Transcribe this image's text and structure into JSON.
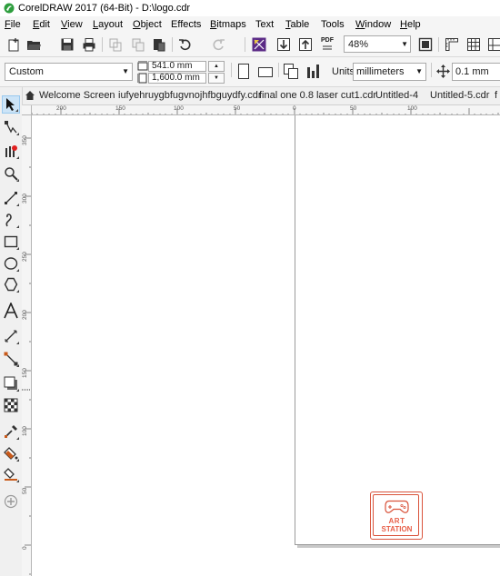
{
  "app": {
    "title": "CorelDRAW 2017 (64-Bit) - D:\\logo.cdr"
  },
  "menu": [
    {
      "label": "File",
      "mnemonic": "F",
      "rest": "ile"
    },
    {
      "label": "Edit",
      "mnemonic": "E",
      "rest": "dit"
    },
    {
      "label": "View",
      "mnemonic": "V",
      "rest": "iew"
    },
    {
      "label": "Layout",
      "mnemonic": "L",
      "rest": "ayout"
    },
    {
      "label": "Object",
      "mnemonic": "O",
      "rest": "bject"
    },
    {
      "label": "Effects",
      "mnemonic": "",
      "rest": "Effects"
    },
    {
      "label": "Bitmaps",
      "mnemonic": "B",
      "rest": "itmaps"
    },
    {
      "label": "Text",
      "mnemonic": "",
      "rest": "Text"
    },
    {
      "label": "Table",
      "mnemonic": "T",
      "rest": "able"
    },
    {
      "label": "Tools",
      "mnemonic": "",
      "rest": "Tools"
    },
    {
      "label": "Window",
      "mnemonic": "W",
      "rest": "indow"
    },
    {
      "label": "Help",
      "mnemonic": "H",
      "rest": "elp"
    }
  ],
  "standard_toolbar": {
    "zoom_level": "48%",
    "icons": [
      "new-document-icon",
      "open-icon",
      "save-icon",
      "print-icon",
      "cut-icon",
      "copy-icon",
      "paste-icon",
      "undo-icon",
      "redo-icon",
      "search-content-icon",
      "import-icon",
      "export-icon",
      "publish-pdf-icon",
      "full-screen-preview-icon",
      "show-rulers-icon",
      "show-grid-icon",
      "show-guidelines-icon"
    ],
    "pdf_label": "PDF"
  },
  "property_bar": {
    "page_preset": "Custom",
    "page_width": "541.0 mm",
    "page_height": "1,600.0 mm",
    "units_label": "Units:",
    "units_value": "millimeters",
    "nudge_value": "0.1 mm"
  },
  "document_tabs": [
    "Welcome Screen",
    "iufyehruygbfugvnojhfbguydfy.cdr",
    "final one 0.8 laser cut1.cdr",
    "Untitled-4",
    "Untitled-5.cdr"
  ],
  "rulers": {
    "horizontal_labels": [
      "200",
      "150",
      "100",
      "50",
      "0",
      "50",
      "100"
    ],
    "vertical_labels": [
      "350",
      "300",
      "250",
      "200",
      "150",
      "100",
      "50",
      "0",
      "0"
    ]
  },
  "toolbox": {
    "tools": [
      "pick-tool-icon",
      "shape-tool-icon",
      "crop-tool-icon",
      "zoom-tool-icon",
      "freehand-tool-icon",
      "artistic-media-tool-icon",
      "rectangle-tool-icon",
      "ellipse-tool-icon",
      "polygon-tool-icon",
      "text-tool-icon",
      "parallel-dimension-tool-icon",
      "connector-tool-icon",
      "drop-shadow-tool-icon",
      "transparency-tool-icon",
      "eyedropper-tool-icon",
      "interactive-fill-tool-icon",
      "smart-fill-tool-icon",
      "add-tool-icon"
    ]
  },
  "canvas": {
    "logo_line1": "ART",
    "logo_line2": "STATION",
    "logo_color": "#d9533b"
  }
}
